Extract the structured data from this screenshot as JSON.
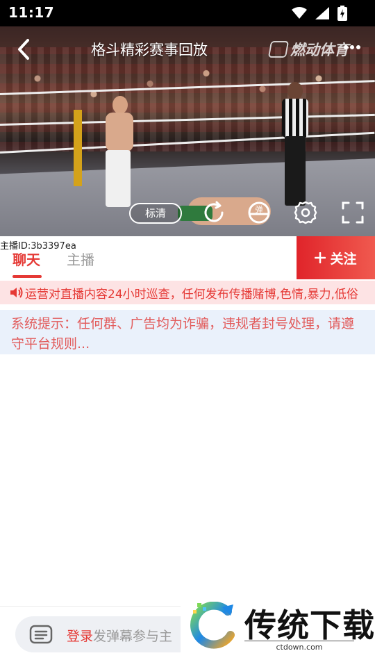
{
  "status_bar": {
    "time": "11:17"
  },
  "video": {
    "title": "格斗精彩赛事回放",
    "watermark_text": "燃动体育",
    "quality_label": "标清",
    "danmaku_icon_text": "弹"
  },
  "tabs": {
    "anchor_id": "主播ID:3b3397ea",
    "chat_label": "聊天",
    "anchor_label": "主播",
    "follow_label": "关注"
  },
  "notice": {
    "text": "运营对直播内容24小时巡查，任何发布传播赌博,色情,暴力,低俗"
  },
  "system_message": {
    "text": "系统提示：任何群、广告均为诈骗，违规者封号处理，请遵守平台规则..."
  },
  "bottom_bar": {
    "login_label": "登录",
    "placeholder": "发弹幕参与主"
  },
  "site_logo": {
    "name": "传统下载",
    "url": "ctdown.com"
  },
  "colors": {
    "accent": "#e53935",
    "notice_bg": "#fde3e4",
    "system_bg": "#eaf1fb"
  }
}
